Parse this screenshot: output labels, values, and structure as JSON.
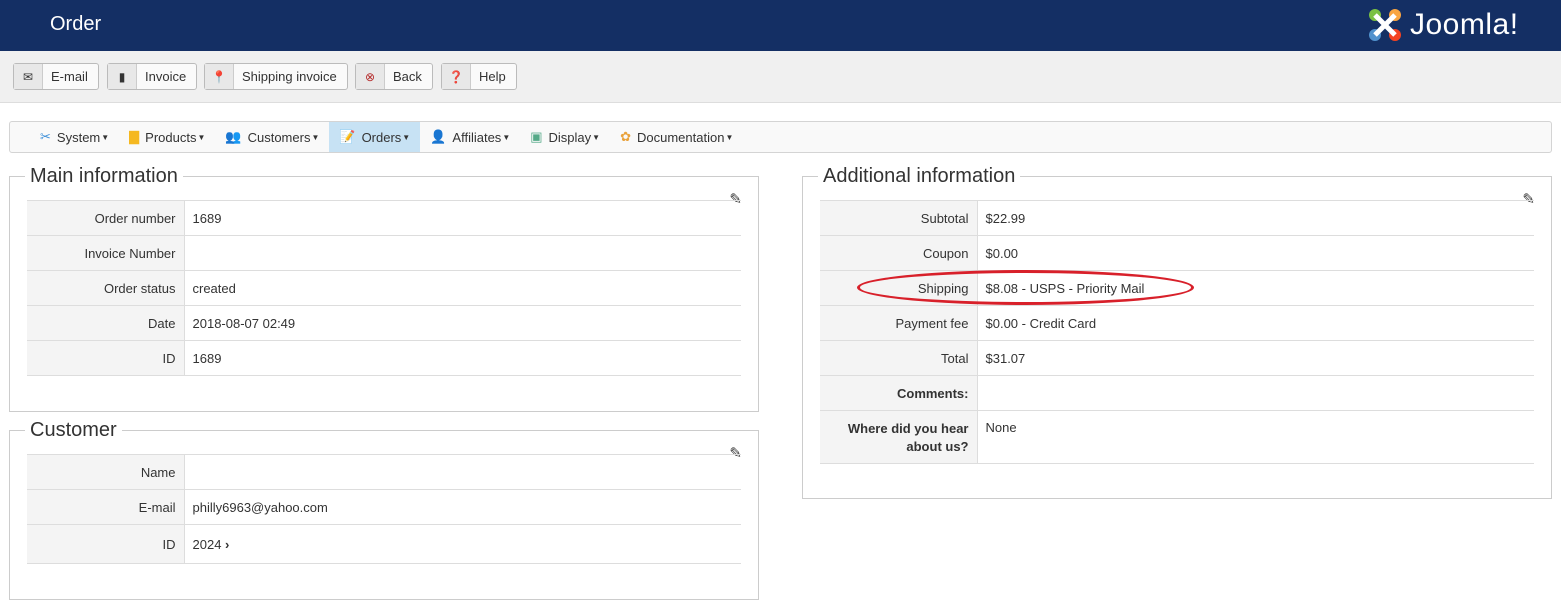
{
  "header": {
    "title": "Order",
    "logo_text": "Joomla!"
  },
  "toolbar": [
    {
      "label": "E-mail",
      "icon": "envelope-icon"
    },
    {
      "label": "Invoice",
      "icon": "book-icon"
    },
    {
      "label": "Shipping invoice",
      "icon": "map-pin-icon"
    },
    {
      "label": "Back",
      "icon": "cancel-icon"
    },
    {
      "label": "Help",
      "icon": "question-icon"
    }
  ],
  "menu": [
    {
      "label": "System"
    },
    {
      "label": "Products"
    },
    {
      "label": "Customers"
    },
    {
      "label": "Orders"
    },
    {
      "label": "Affiliates"
    },
    {
      "label": "Display"
    },
    {
      "label": "Documentation"
    }
  ],
  "main": {
    "title": "Main information",
    "rows": [
      {
        "k": "Order number",
        "v": "1689"
      },
      {
        "k": "Invoice Number",
        "v": ""
      },
      {
        "k": "Order status",
        "v": "created"
      },
      {
        "k": "Date",
        "v": "2018-08-07 02:49"
      },
      {
        "k": "ID",
        "v": "1689"
      }
    ]
  },
  "customer": {
    "title": "Customer",
    "rows": [
      {
        "k": "Name",
        "v": ""
      },
      {
        "k": "E-mail",
        "v": "philly6963@yahoo.com"
      },
      {
        "k": "ID",
        "v": "2024"
      }
    ]
  },
  "additional": {
    "title": "Additional information",
    "rows": [
      {
        "k": "Subtotal",
        "v": "$22.99"
      },
      {
        "k": "Coupon",
        "v": "$0.00"
      },
      {
        "k": "Shipping",
        "v": "$8.08 - USPS - Priority Mail"
      },
      {
        "k": "Payment fee",
        "v": "$0.00 - Credit Card"
      },
      {
        "k": "Total",
        "v": "$31.07"
      },
      {
        "k": "Comments:",
        "v": ""
      },
      {
        "k": "Where did you hear about us?",
        "v": "None"
      }
    ]
  }
}
